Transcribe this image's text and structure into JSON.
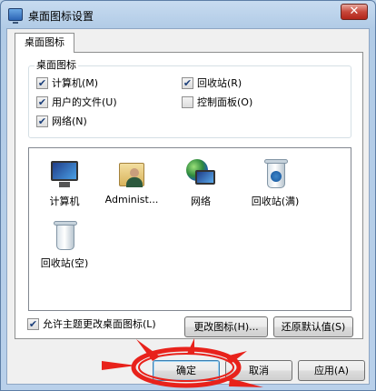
{
  "window": {
    "title": "桌面图标设置",
    "close_glyph": "✕"
  },
  "tabs": [
    {
      "label": "桌面图标"
    }
  ],
  "desktop_icons_group": {
    "title": "桌面图标",
    "checkboxes": [
      {
        "label": "计算机(M)",
        "checked": true
      },
      {
        "label": "回收站(R)",
        "checked": true
      },
      {
        "label": "用户的文件(U)",
        "checked": true
      },
      {
        "label": "控制面板(O)",
        "checked": false
      },
      {
        "label": "网络(N)",
        "checked": true
      }
    ]
  },
  "icon_list": [
    {
      "label": "计算机",
      "icon": "computer-icon"
    },
    {
      "label": "Administ...",
      "icon": "user-folder-icon"
    },
    {
      "label": "网络",
      "icon": "network-icon"
    },
    {
      "label": "回收站(满)",
      "icon": "recycle-bin-full-icon"
    },
    {
      "label": "回收站(空)",
      "icon": "recycle-bin-empty-icon"
    }
  ],
  "buttons": {
    "change_icon": "更改图标(H)...",
    "restore_default": "还原默认值(S)",
    "ok": "确定",
    "cancel": "取消",
    "apply": "应用(A)"
  },
  "allow_themes": {
    "label": "允许主题更改桌面图标(L)",
    "checked": true
  },
  "colors": {
    "annotation": "#e8221b",
    "accent": "#3c7fb1"
  }
}
